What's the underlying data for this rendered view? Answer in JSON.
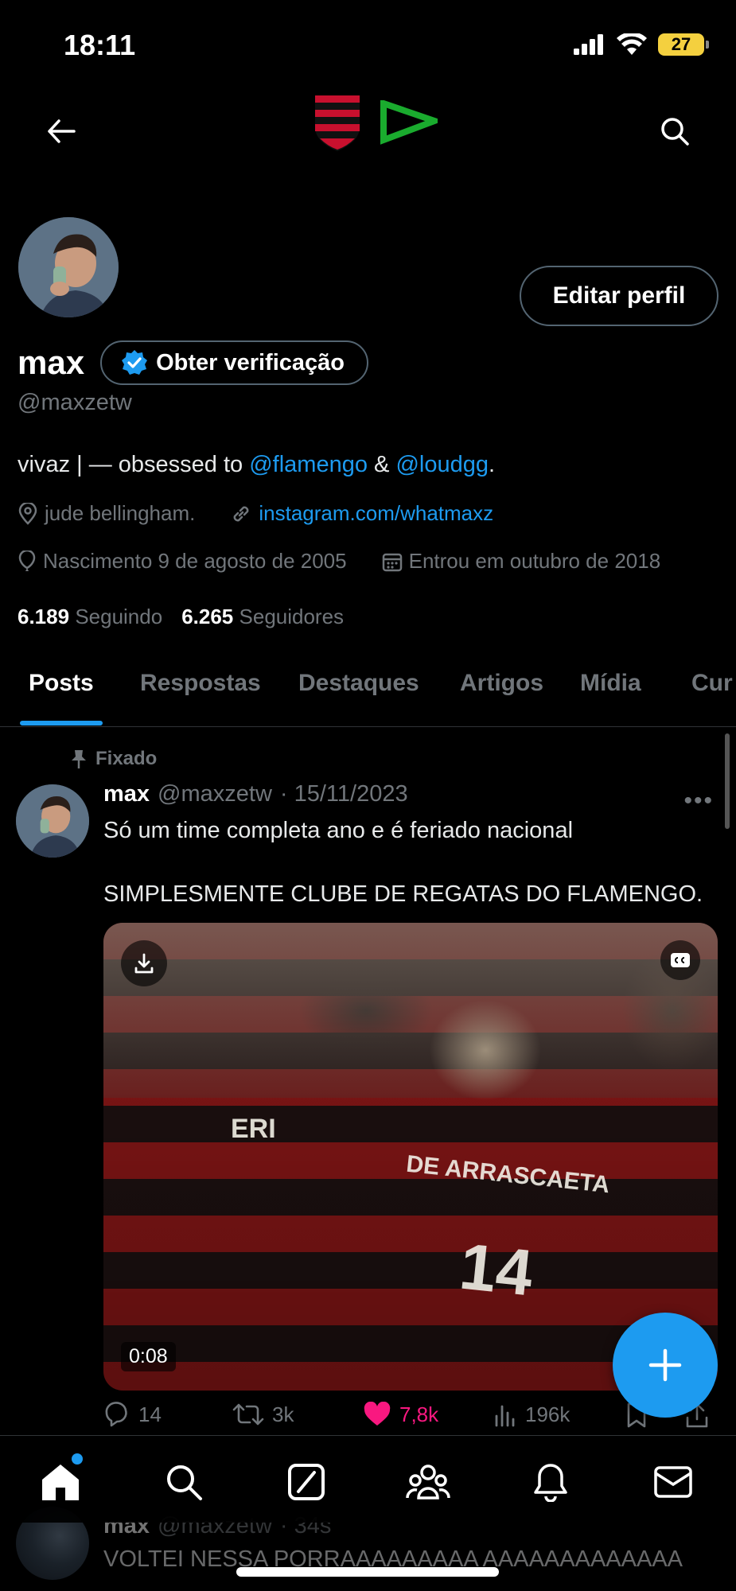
{
  "status_bar": {
    "time": "18:11",
    "battery": "27"
  },
  "profile": {
    "name": "max",
    "verify_label": "Obter verificação",
    "handle": "@maxzetw",
    "edit_label": "Editar perfil",
    "bio_prefix": "vivaz | — obsessed to ",
    "bio_mention_1": "@flamengo",
    "bio_mid": " & ",
    "bio_mention_2": "@loudgg",
    "bio_suffix": ".",
    "location": "jude bellingham.",
    "website": "instagram.com/whatmaxz",
    "birth": "Nascimento 9 de agosto de 2005",
    "joined": "Entrou em outubro de 2018",
    "following_count": "6.189",
    "following_label": "Seguindo",
    "followers_count": "6.265",
    "followers_label": "Seguidores"
  },
  "tabs": [
    "Posts",
    "Respostas",
    "Destaques",
    "Artigos",
    "Mídia",
    "Cur"
  ],
  "pinned_post": {
    "pinned_label": "Fixado",
    "name": "max",
    "handle": "@maxzetw",
    "date": "· 15/11/2023",
    "text_line_1": "Só um time completa ano e é feriado nacional",
    "text_line_2": "SIMPLESMENTE CLUBE DE REGATAS DO FLAMENGO.",
    "video_duration": "0:08",
    "jersey_name_1": "DE ARRASCAETA",
    "jersey_number_1": "14",
    "jersey_name_2": "ERI",
    "replies": "14",
    "reposts": "3k",
    "likes": "7,8k",
    "views": "196k"
  },
  "next_post": {
    "name": "max",
    "handle": "@maxzetw",
    "time": "· 34s",
    "text": "VOLTEI NESSA PORRAAAAAAAAA AAAAAAAAAAAAA"
  },
  "colors": {
    "accent": "#1d9bf0",
    "like": "#f91880",
    "muted": "#71767b",
    "border": "#536471"
  },
  "icons": {
    "back": "arrow-left-icon",
    "search": "search-icon",
    "pin": "pin-icon",
    "location": "location-pin-icon",
    "link": "link-icon",
    "balloon": "birthday-balloon-icon",
    "calendar": "calendar-icon",
    "verified": "verified-badge-icon"
  }
}
